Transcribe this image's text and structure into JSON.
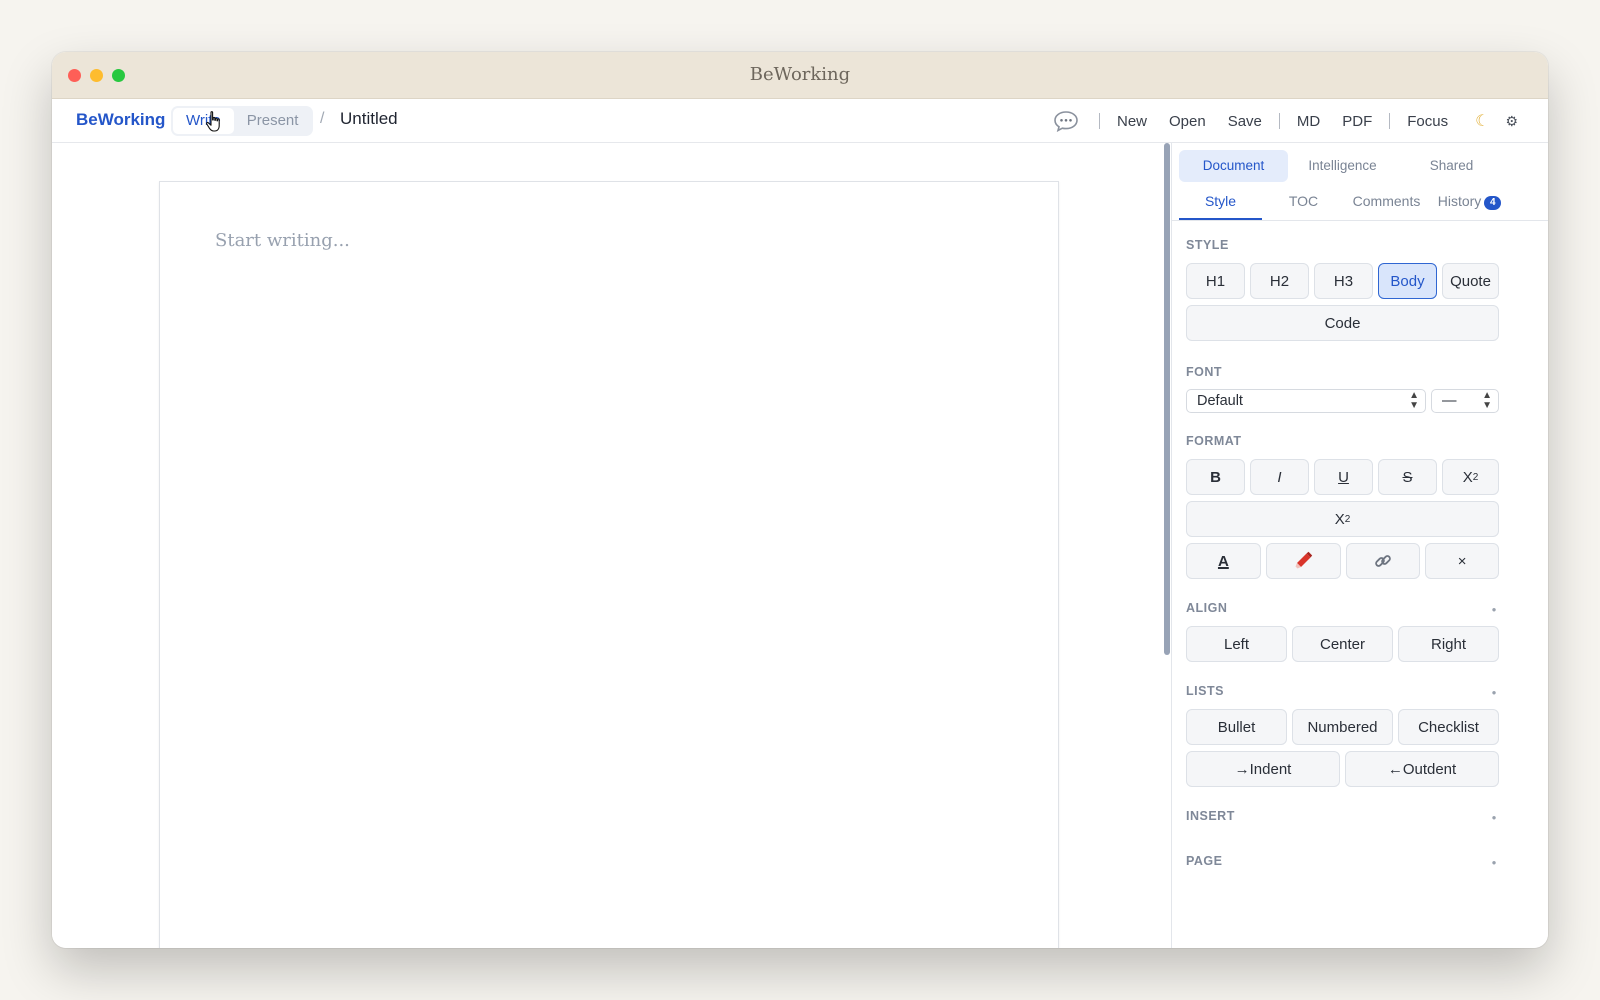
{
  "window": {
    "title": "BeWorking"
  },
  "toolbar": {
    "brand": "BeWorking",
    "modes": [
      "Write",
      "Present"
    ],
    "crumb_separator": "/",
    "doc_title": "Untitled",
    "actions": [
      "New",
      "Open",
      "Save",
      "MD",
      "PDF",
      "Focus"
    ]
  },
  "editor": {
    "placeholder": "Start writing..."
  },
  "sidebar": {
    "top_tabs": [
      "Document",
      "Intelligence",
      "Shared"
    ],
    "sub_tabs": [
      "Style",
      "TOC",
      "Comments",
      "History"
    ],
    "history_count": "4",
    "style": {
      "label": "STYLE",
      "buttons": [
        "H1",
        "H2",
        "H3",
        "Body",
        "Quote"
      ],
      "code": "Code",
      "selected": "Body"
    },
    "font": {
      "label": "FONT",
      "family": "Default",
      "size": "—"
    },
    "format": {
      "label": "FORMAT",
      "bold": "B",
      "italic": "I",
      "underline": "U",
      "strike": "S",
      "sup_base": "X",
      "sup": "2",
      "sub_base": "X",
      "sub": "2",
      "clear": "×",
      "text_color_glyph": "A"
    },
    "align": {
      "label": "ALIGN",
      "buttons": [
        "Left",
        "Center",
        "Right"
      ]
    },
    "lists": {
      "label": "LISTS",
      "buttons": [
        "Bullet",
        "Numbered",
        "Checklist"
      ],
      "indent": "→Indent",
      "outdent": "←Outdent"
    },
    "insert": {
      "label": "INSERT"
    },
    "page": {
      "label": "PAGE"
    }
  },
  "colors": {
    "accent": "#2456c9",
    "titlebar": "#ece5d8",
    "scrollbar": "#98a3b6"
  }
}
